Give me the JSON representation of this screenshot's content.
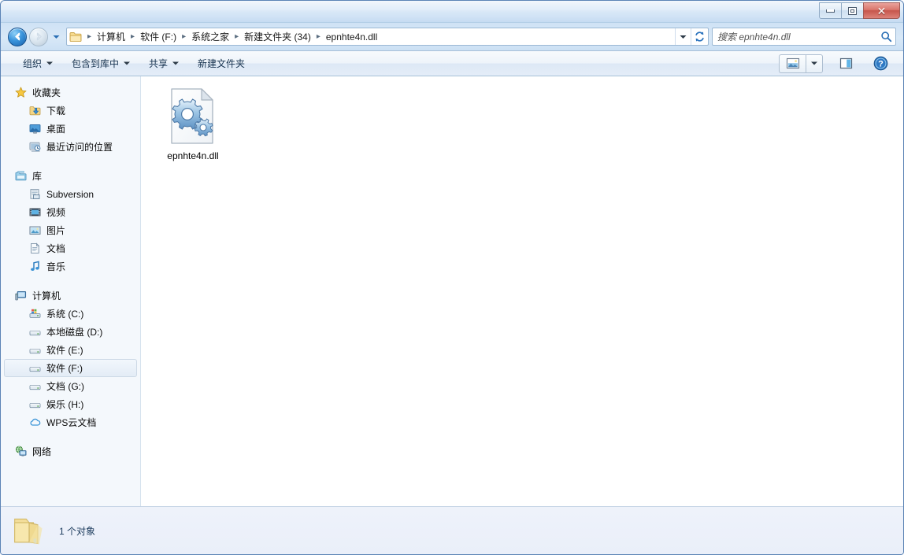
{
  "window": {
    "buttons": {
      "minimize": "minimize-button",
      "maximize": "restore-button",
      "close": "close-button"
    }
  },
  "addressbar": {
    "back_tooltip": "后退",
    "forward_tooltip": "前进",
    "breadcrumbs": [
      "计算机",
      "软件 (F:)",
      "系统之家",
      "新建文件夹 (34)",
      "epnhte4n.dll"
    ],
    "separator": "▸",
    "refresh_label": "刷新"
  },
  "search": {
    "placeholder": "搜索 epnhte4n.dll",
    "value": ""
  },
  "toolbar": {
    "items": [
      {
        "label": "组织",
        "has_dropdown": true
      },
      {
        "label": "包含到库中",
        "has_dropdown": true
      },
      {
        "label": "共享",
        "has_dropdown": true
      },
      {
        "label": "新建文件夹",
        "has_dropdown": false
      }
    ],
    "view_button": "change-view-button",
    "preview_button": "preview-pane-button",
    "help_button": "help-button"
  },
  "sidebar": {
    "groups": [
      {
        "header": {
          "label": "收藏夹",
          "icon": "star-icon"
        },
        "items": [
          {
            "label": "下载",
            "icon": "downloads-icon"
          },
          {
            "label": "桌面",
            "icon": "desktop-icon"
          },
          {
            "label": "最近访问的位置",
            "icon": "recent-places-icon"
          }
        ]
      },
      {
        "header": {
          "label": "库",
          "icon": "library-icon"
        },
        "items": [
          {
            "label": "Subversion",
            "icon": "subversion-icon"
          },
          {
            "label": "视频",
            "icon": "videos-icon"
          },
          {
            "label": "图片",
            "icon": "pictures-icon"
          },
          {
            "label": "文档",
            "icon": "documents-icon"
          },
          {
            "label": "音乐",
            "icon": "music-icon"
          }
        ]
      },
      {
        "header": {
          "label": "计算机",
          "icon": "computer-icon"
        },
        "items": [
          {
            "label": "系统 (C:)",
            "icon": "system-drive-icon",
            "selected": false
          },
          {
            "label": "本地磁盘 (D:)",
            "icon": "drive-icon",
            "selected": false
          },
          {
            "label": "软件 (E:)",
            "icon": "drive-icon",
            "selected": false
          },
          {
            "label": "软件 (F:)",
            "icon": "drive-icon",
            "selected": true
          },
          {
            "label": "文档 (G:)",
            "icon": "drive-icon",
            "selected": false
          },
          {
            "label": "娱乐 (H:)",
            "icon": "drive-icon",
            "selected": false
          },
          {
            "label": "WPS云文档",
            "icon": "cloud-icon",
            "selected": false
          }
        ]
      },
      {
        "header": {
          "label": "网络",
          "icon": "network-icon"
        },
        "items": []
      }
    ]
  },
  "content": {
    "files": [
      {
        "name": "epnhte4n.dll",
        "icon": "dll-file-icon"
      }
    ]
  },
  "statusbar": {
    "icon": "open-folder-icon",
    "text": "1 个对象"
  }
}
